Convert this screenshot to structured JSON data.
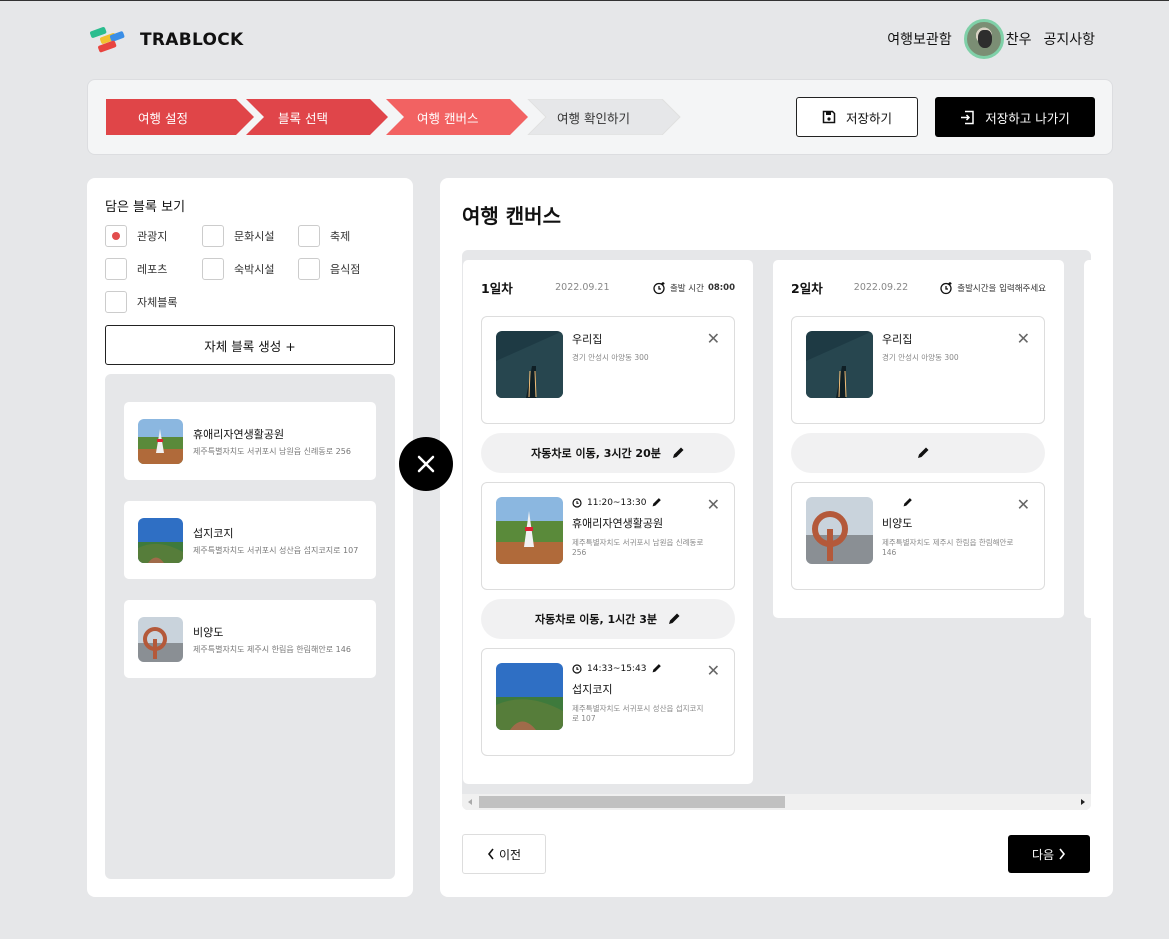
{
  "header": {
    "logo_text": "TRABLOCK",
    "nav": {
      "storage": "여행보관함",
      "user": "찬우",
      "notice": "공지사항"
    }
  },
  "stepper": {
    "steps": [
      {
        "label": "여행 설정",
        "state": "done"
      },
      {
        "label": "블록 선택",
        "state": "done"
      },
      {
        "label": "여행 캔버스",
        "state": "active"
      },
      {
        "label": "여행 확인하기",
        "state": "pending"
      }
    ],
    "save_label": "저장하기",
    "save_exit_label": "저장하고 나가기"
  },
  "left_panel": {
    "title": "담은 블록 보기",
    "filters": [
      {
        "label": "관광지",
        "checked": true
      },
      {
        "label": "문화시설",
        "checked": false
      },
      {
        "label": "축제",
        "checked": false
      },
      {
        "label": "레포츠",
        "checked": false
      },
      {
        "label": "숙박시설",
        "checked": false
      },
      {
        "label": "음식점",
        "checked": false
      },
      {
        "label": "자체블록",
        "checked": false
      }
    ],
    "create_label": "자체 블록 생성 +",
    "blocks": [
      {
        "name": "휴애리자연생활공원",
        "address": "제주특별자치도 서귀포시 남원읍 신례동로 256"
      },
      {
        "name": "섭지코지",
        "address": "제주특별자치도 서귀포시 성산읍 섭지코지로 107"
      },
      {
        "name": "비양도",
        "address": "제주특별자치도 제주시 한림읍 한림해안로 146"
      }
    ]
  },
  "main": {
    "title": "여행 캔버스",
    "days": [
      {
        "label": "1일차",
        "date": "2022.09.21",
        "time_label": "출발 시간",
        "time_value": "08:00",
        "places": [
          {
            "name": "우리집",
            "address": "경기 안성시 아양동 300",
            "time": ""
          },
          {
            "name": "휴애리자연생활공원",
            "address": "제주특별자치도 서귀포시 남원읍 신례동로 256",
            "time": "11:20~13:30"
          },
          {
            "name": "섭지코지",
            "address": "제주특별자치도 서귀포시 성산읍 섭지코지로 107",
            "time": "14:33~15:43"
          }
        ],
        "moves": [
          "자동차로 이동, 3시간 20분",
          "자동차로 이동, 1시간 3분"
        ]
      },
      {
        "label": "2일차",
        "date": "2022.09.22",
        "time_label": "출발시간을 입력해주세요",
        "time_value": "",
        "places": [
          {
            "name": "우리집",
            "address": "경기 안성시 아양동 300",
            "time": ""
          },
          {
            "name": "비양도",
            "address": "제주특별자치도 제주시 한림읍 한림해안로 146",
            "time": ""
          }
        ],
        "moves": [
          ""
        ]
      }
    ],
    "prev_label": "이전",
    "next_label": "다음"
  },
  "colors": {
    "step_done": "#e24549",
    "step_active": "#f26262",
    "step_pending": "#e6e7e9",
    "accent": "#e24d4d"
  }
}
